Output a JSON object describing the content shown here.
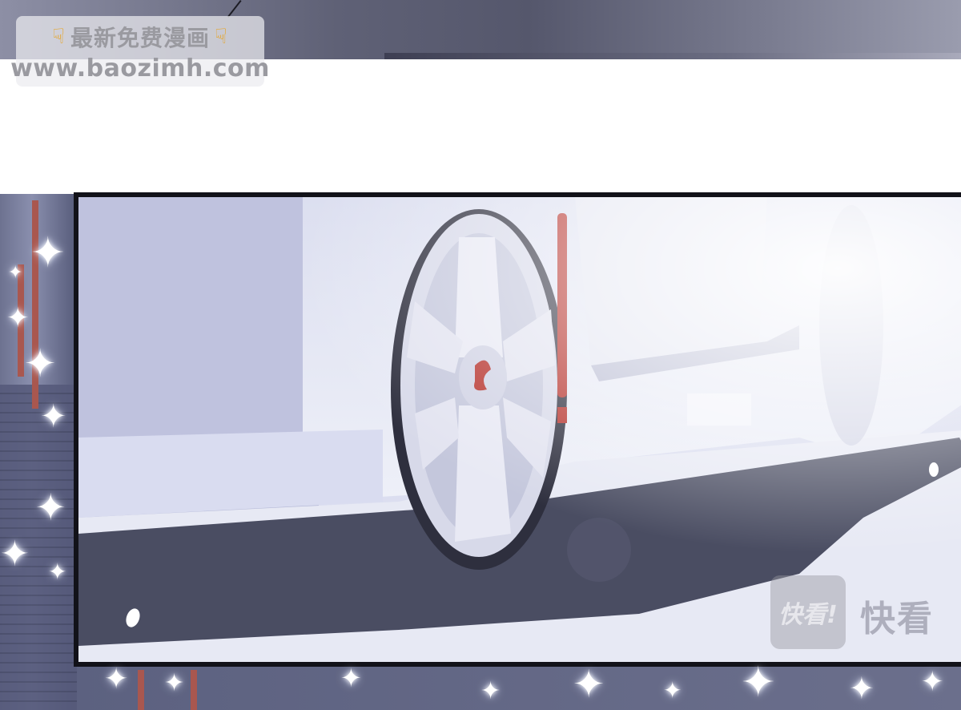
{
  "watermark": {
    "title": "最新免费漫画",
    "url": "www.baozimh.com",
    "left_icon": "pointing-down-hand-icon",
    "right_icon": "pointing-down-hand-icon"
  },
  "publisher_logo": {
    "badge_text": "快看!",
    "wordmark": "快看"
  },
  "colors": {
    "panel_border": "#121219",
    "car_body": "#e8e9f3",
    "wheel_accent": "#b5302a",
    "shadow": "#3d3f55"
  }
}
